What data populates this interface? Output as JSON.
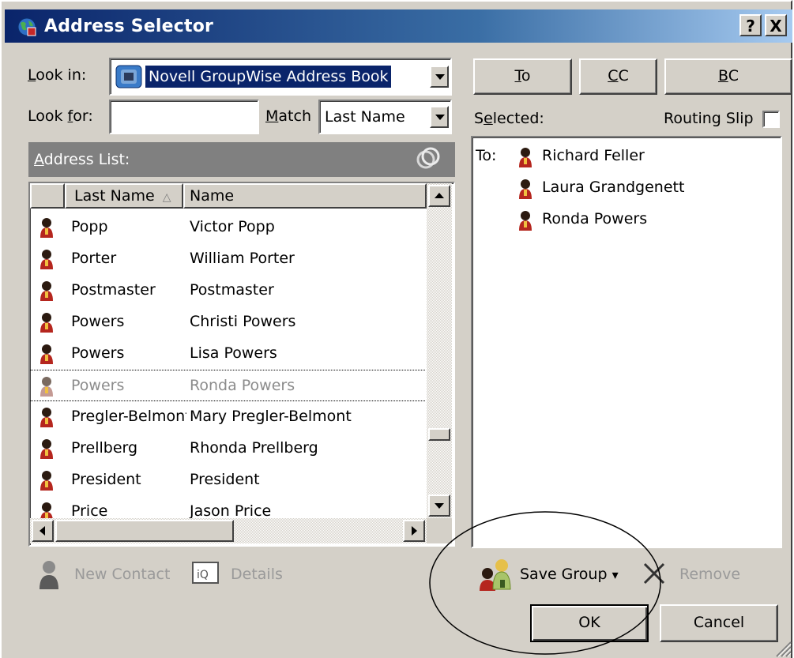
{
  "window": {
    "title": "Address Selector",
    "help_label": "?",
    "close_label": "X"
  },
  "look_in": {
    "label_access": "L",
    "label_rest": "ook in:",
    "value": "Novell GroupWise Address Book"
  },
  "look_for": {
    "label_pre": "Look ",
    "label_access": "f",
    "label_post": "or:",
    "value": "",
    "match_access": "M",
    "match_rest": "atch",
    "match_value": "Last Name"
  },
  "address_list": {
    "label_access": "A",
    "label_rest": "ddress List:",
    "columns": [
      "Last Name",
      "Name"
    ],
    "sort_indicator": "△",
    "rows": [
      {
        "last": "Popp",
        "name": "Victor Popp",
        "dim": false
      },
      {
        "last": "Porter",
        "name": "William Porter",
        "dim": false
      },
      {
        "last": "Postmaster",
        "name": "Postmaster",
        "dim": false
      },
      {
        "last": "Powers",
        "name": "Christi Powers",
        "dim": false
      },
      {
        "last": "Powers",
        "name": "Lisa Powers",
        "dim": false
      },
      {
        "last": "Powers",
        "name": "Ronda Powers",
        "dim": true
      },
      {
        "last": "Pregler-Belmont",
        "name": "Mary Pregler-Belmont",
        "dim": false
      },
      {
        "last": "Prellberg",
        "name": "Rhonda Prellberg",
        "dim": false
      },
      {
        "last": "President",
        "name": "President",
        "dim": false
      },
      {
        "last": "Price",
        "name": "Jason Price",
        "dim": false
      }
    ]
  },
  "recipient_buttons": {
    "to_access": "T",
    "to_rest": "o",
    "cc_access": "C",
    "cc_rest": "C",
    "bc_access": "B",
    "bc_rest": "C"
  },
  "selected": {
    "label_pre": "S",
    "label_access": "e",
    "label_rest": "lected:",
    "routing_slip": "Routing Slip",
    "routing_checked": false,
    "to_prefix": "To:",
    "recipients": [
      "Richard Feller",
      "Laura Grandgenett",
      "Ronda Powers"
    ]
  },
  "left_actions": {
    "new_contact": "New Contact",
    "details": "Details"
  },
  "right_actions": {
    "save_group": "Save Group",
    "dropdown_arrow": "▾",
    "remove": "Remove"
  },
  "dialog_buttons": {
    "ok": "OK",
    "cancel": "Cancel"
  },
  "colors": {
    "title_gradient_start": "#0a246a",
    "title_gradient_end": "#a6caf0",
    "dialog_bg": "#d4d0c8",
    "selection_bg": "#0a246a",
    "person_icon": "#b5261e"
  },
  "icons": {
    "title": "address-book-globe-icon",
    "look_in": "groupwise-book-icon",
    "address_list": "address-book-rings-icon",
    "contact": "person-icon",
    "new_contact": "new-contact-icon",
    "details": "details-icon",
    "save_group": "group-icon",
    "remove": "remove-x-icon"
  }
}
